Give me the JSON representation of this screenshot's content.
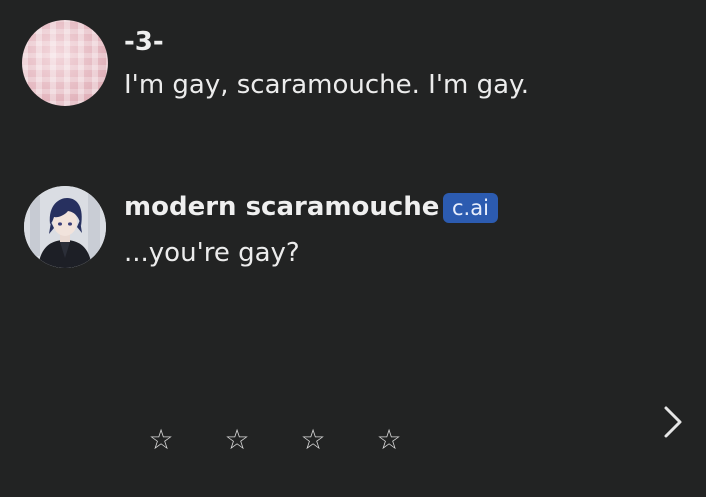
{
  "messages": [
    {
      "author": "-3-",
      "text": "I'm gay, scaramouche. I'm gay."
    },
    {
      "author": "modern scaramouche",
      "badge": "c.ai",
      "text": "...you're gay?"
    }
  ],
  "rating": {
    "stars": [
      "☆",
      "☆",
      "☆",
      "☆"
    ],
    "value": 0,
    "max": 4
  },
  "controls": {
    "next_icon": "chevron-right-icon"
  },
  "colors": {
    "background": "#222323",
    "badge": "#2c5bb0",
    "text": "#ececec"
  }
}
